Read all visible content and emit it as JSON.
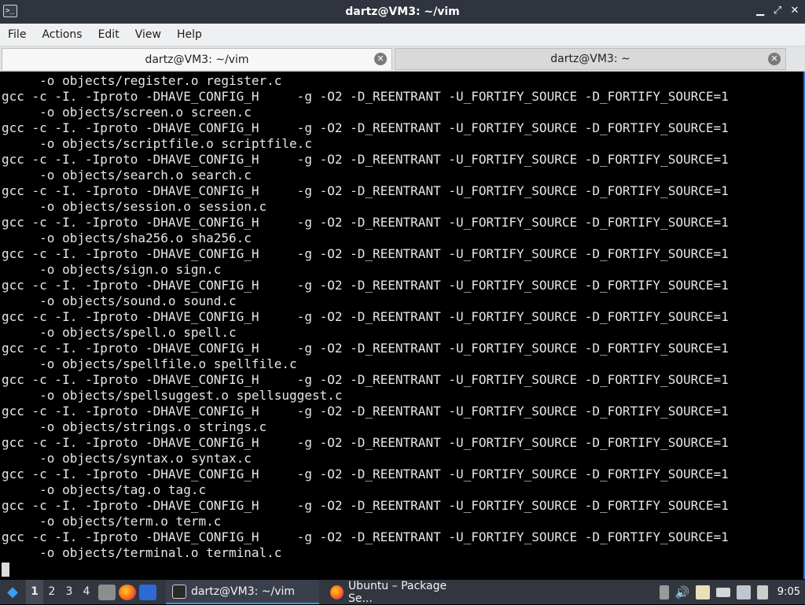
{
  "window": {
    "title": "dartz@VM3: ~/vim",
    "controls": [
      "▁",
      "⤢",
      "✕"
    ]
  },
  "menu": {
    "items": [
      "File",
      "Actions",
      "Edit",
      "View",
      "Help"
    ]
  },
  "tabs": [
    {
      "label": "dartz@VM3: ~/vim",
      "active": true
    },
    {
      "label": "dartz@VM3: ~",
      "active": false
    }
  ],
  "terminal": {
    "lines": [
      "     -o objects/register.o register.c",
      "gcc -c -I. -Iproto -DHAVE_CONFIG_H     -g -O2 -D_REENTRANT -U_FORTIFY_SOURCE -D_FORTIFY_SOURCE=1",
      "     -o objects/screen.o screen.c",
      "gcc -c -I. -Iproto -DHAVE_CONFIG_H     -g -O2 -D_REENTRANT -U_FORTIFY_SOURCE -D_FORTIFY_SOURCE=1",
      "     -o objects/scriptfile.o scriptfile.c",
      "gcc -c -I. -Iproto -DHAVE_CONFIG_H     -g -O2 -D_REENTRANT -U_FORTIFY_SOURCE -D_FORTIFY_SOURCE=1",
      "     -o objects/search.o search.c",
      "gcc -c -I. -Iproto -DHAVE_CONFIG_H     -g -O2 -D_REENTRANT -U_FORTIFY_SOURCE -D_FORTIFY_SOURCE=1",
      "     -o objects/session.o session.c",
      "gcc -c -I. -Iproto -DHAVE_CONFIG_H     -g -O2 -D_REENTRANT -U_FORTIFY_SOURCE -D_FORTIFY_SOURCE=1",
      "     -o objects/sha256.o sha256.c",
      "gcc -c -I. -Iproto -DHAVE_CONFIG_H     -g -O2 -D_REENTRANT -U_FORTIFY_SOURCE -D_FORTIFY_SOURCE=1",
      "     -o objects/sign.o sign.c",
      "gcc -c -I. -Iproto -DHAVE_CONFIG_H     -g -O2 -D_REENTRANT -U_FORTIFY_SOURCE -D_FORTIFY_SOURCE=1",
      "     -o objects/sound.o sound.c",
      "gcc -c -I. -Iproto -DHAVE_CONFIG_H     -g -O2 -D_REENTRANT -U_FORTIFY_SOURCE -D_FORTIFY_SOURCE=1",
      "     -o objects/spell.o spell.c",
      "gcc -c -I. -Iproto -DHAVE_CONFIG_H     -g -O2 -D_REENTRANT -U_FORTIFY_SOURCE -D_FORTIFY_SOURCE=1",
      "     -o objects/spellfile.o spellfile.c",
      "gcc -c -I. -Iproto -DHAVE_CONFIG_H     -g -O2 -D_REENTRANT -U_FORTIFY_SOURCE -D_FORTIFY_SOURCE=1",
      "     -o objects/spellsuggest.o spellsuggest.c",
      "gcc -c -I. -Iproto -DHAVE_CONFIG_H     -g -O2 -D_REENTRANT -U_FORTIFY_SOURCE -D_FORTIFY_SOURCE=1",
      "     -o objects/strings.o strings.c",
      "gcc -c -I. -Iproto -DHAVE_CONFIG_H     -g -O2 -D_REENTRANT -U_FORTIFY_SOURCE -D_FORTIFY_SOURCE=1",
      "     -o objects/syntax.o syntax.c",
      "gcc -c -I. -Iproto -DHAVE_CONFIG_H     -g -O2 -D_REENTRANT -U_FORTIFY_SOURCE -D_FORTIFY_SOURCE=1",
      "     -o objects/tag.o tag.c",
      "gcc -c -I. -Iproto -DHAVE_CONFIG_H     -g -O2 -D_REENTRANT -U_FORTIFY_SOURCE -D_FORTIFY_SOURCE=1",
      "     -o objects/term.o term.c",
      "gcc -c -I. -Iproto -DHAVE_CONFIG_H     -g -O2 -D_REENTRANT -U_FORTIFY_SOURCE -D_FORTIFY_SOURCE=1",
      "     -o objects/terminal.o terminal.c"
    ]
  },
  "taskbar": {
    "workspaces": [
      "1",
      "2",
      "3",
      "4"
    ],
    "active_workspace": "1",
    "tasks": [
      {
        "label": "dartz@VM3: ~/vim",
        "icon": "terminal-icon",
        "active": true
      },
      {
        "label": "Ubuntu – Package Se...",
        "icon": "firefox-icon",
        "active": false
      }
    ],
    "clock": "9:05"
  },
  "colors": {
    "titlebar": "#2f343f",
    "terminal_bg": "#000000",
    "terminal_fg": "#e6e6e6",
    "taskbar": "#31363f",
    "accent": "#4a90d9"
  }
}
